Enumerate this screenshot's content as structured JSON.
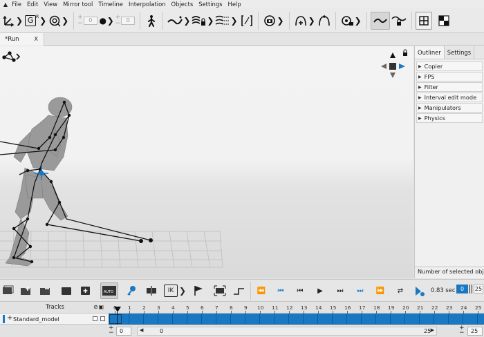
{
  "menu": {
    "items": [
      "File",
      "Edit",
      "View",
      "Mirror tool",
      "Timeline",
      "Interpolation",
      "Objects",
      "Settings",
      "Help"
    ]
  },
  "toolbar": {
    "spin_left_value": "0",
    "spin_right_value": "0",
    "g_label": "G",
    "g_sup": "R"
  },
  "tab": {
    "label": "*Run",
    "close": "X"
  },
  "right_panel": {
    "tabs": [
      "Outliner",
      "Settings"
    ],
    "items": [
      "Copier",
      "FPS",
      "Filter",
      "Interval edit mode",
      "Manipulators",
      "Physics"
    ],
    "footer": "Number of selected obje"
  },
  "controls": {
    "time_value": "0.83 sec",
    "frame_current": "0",
    "frame_total": "25",
    "ik_label": "IK",
    "auto_label": "AUTO"
  },
  "tracks": {
    "header": "Tracks",
    "model_name": "Standard_model",
    "ruler_ticks": [
      "0",
      "1",
      "2",
      "3",
      "4",
      "5",
      "6",
      "7",
      "8",
      "9",
      "10",
      "11",
      "12",
      "13",
      "14",
      "15",
      "16",
      "17",
      "18",
      "19",
      "20",
      "21",
      "22",
      "23",
      "24",
      "25"
    ],
    "range_start": "0",
    "scroll_start": "0",
    "scroll_end": "25",
    "range_end": "25"
  },
  "colors": {
    "accent": "#1a78c2",
    "toolbar_bg": "#eaeaea"
  }
}
